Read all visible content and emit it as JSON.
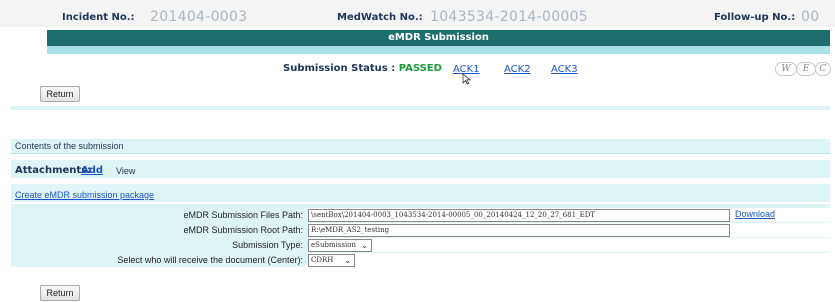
{
  "header": {
    "incident_label": "Incident No.:",
    "incident_value": "201404-0003",
    "medwatch_label": "MedWatch No.:",
    "medwatch_value": "1043534-2014-00005",
    "followup_label": "Follow-up No.:",
    "followup_value": "00"
  },
  "title": "eMDR Submission",
  "submission": {
    "status_label": "Submission Status :",
    "status_value": "PASSED",
    "acks": [
      "ACK1",
      "ACK2",
      "ACK3"
    ]
  },
  "corner_buttons": [
    "W",
    "E",
    "C"
  ],
  "buttons": {
    "return_top": "Return",
    "return_bottom": "Return"
  },
  "contents_heading": "Contents of the submission",
  "attachments": {
    "label": "Attachments:",
    "add": "Add",
    "view": "View"
  },
  "create_link": "Create eMDR submission package",
  "form": {
    "files_path_label": "eMDR Submission Files Path:",
    "files_path_value": "\\sentBox\\201404-0003_1043534-2014-00005_00_20140424_12_20_27_681_EDT",
    "download": "Download",
    "root_path_label": "eMDR Submission Root Path:",
    "root_path_value": "R:\\eMDR_AS2_testing",
    "type_label": "Submission Type:",
    "type_value": "eSubmission",
    "center_label": "Select who will receive the document (Center):",
    "center_value": "CDRH"
  },
  "colors": {
    "title_bar": "#1e6f6b",
    "panel_bg": "#dff4f6",
    "link": "#1a55c8",
    "status_passed": "#1a9a3a"
  }
}
